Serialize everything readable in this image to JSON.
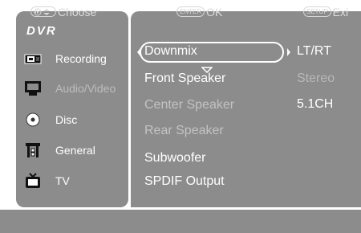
{
  "sidebar": {
    "title": "DVR",
    "items": [
      {
        "label": "Recording",
        "icon": "recording-icon",
        "active": true
      },
      {
        "label": "Audio/Video",
        "icon": "monitor-icon",
        "active": false
      },
      {
        "label": "Disc",
        "icon": "disc-icon",
        "active": true
      },
      {
        "label": "General",
        "icon": "general-settings-icon",
        "active": true
      },
      {
        "label": "TV",
        "icon": "tv-icon",
        "active": true
      }
    ]
  },
  "settings": {
    "rows": [
      {
        "label": "Downmix",
        "value": "LT/RT",
        "selected": true,
        "dim_label": false,
        "dim_value": false
      },
      {
        "label": "Front Speaker",
        "value": "Stereo",
        "selected": false,
        "dim_label": false,
        "dim_value": true
      },
      {
        "label": "Center Speaker",
        "value": "5.1CH",
        "selected": false,
        "dim_label": true,
        "dim_value": false
      },
      {
        "label": "Rear Speaker",
        "value": "",
        "selected": false,
        "dim_label": true,
        "dim_value": false
      },
      {
        "label": "Subwoofer",
        "value": "",
        "selected": false,
        "dim_label": false,
        "dim_value": false
      },
      {
        "label": "SPDIF Output",
        "value": "",
        "selected": false,
        "dim_label": false,
        "dim_value": false
      }
    ]
  },
  "footer": {
    "choose_label": "Choose",
    "enter_key": "ENTER",
    "ok_label": "OK",
    "setup_key": "SETUP",
    "exit_label": "Exi"
  },
  "colors": {
    "panel": "#8c8c8c",
    "text": "#ffffff",
    "dim_text": "#bdbdbd",
    "background": "#ffffff"
  }
}
